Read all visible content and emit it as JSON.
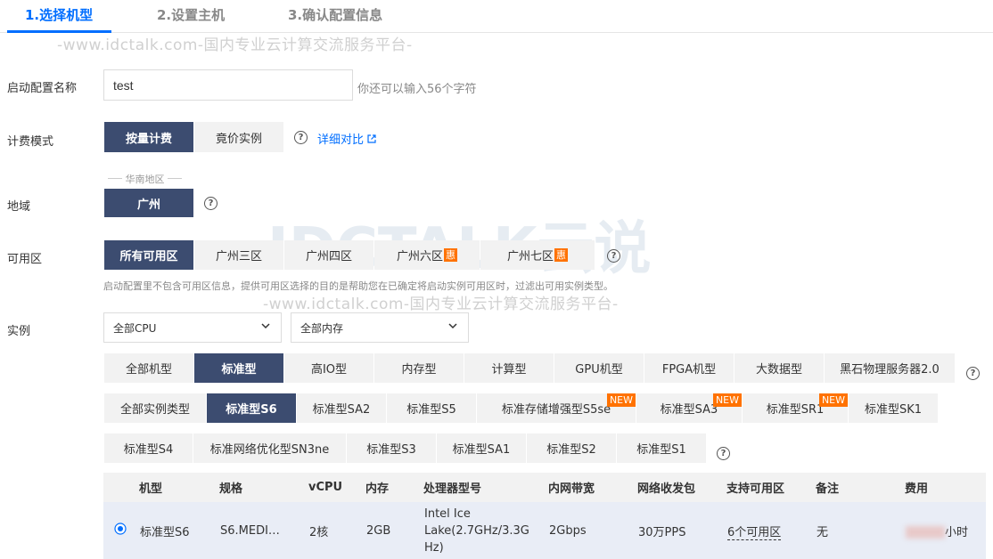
{
  "steps": [
    {
      "label": "1.选择机型"
    },
    {
      "label": "2.设置主机"
    },
    {
      "label": "3.确认配置信息"
    }
  ],
  "watermark": {
    "text": "-www.idctalk.com-国内专业云计算交流服务平台-",
    "logo": "IDCTALK云说"
  },
  "config_name": {
    "label": "启动配置名称",
    "value": "test",
    "hint": "你还可以输入56个字符"
  },
  "billing": {
    "label": "计费模式",
    "options": [
      "按量计费",
      "竟价实例"
    ],
    "selected": "按量计费",
    "compare_link": "详细对比"
  },
  "region": {
    "label": "地域",
    "group_label": "华南地区",
    "options": [
      "广州"
    ]
  },
  "zone": {
    "label": "可用区",
    "options": [
      "所有可用区",
      "广州三区",
      "广州四区",
      "广州六区",
      "广州七区"
    ],
    "discount_badge": "惠",
    "hint": "启动配置里不包含可用区信息，提供可用区选择的目的是帮助您在已确定将启动实例可用区时，过滤出可用实例类型。"
  },
  "instance": {
    "label": "实例",
    "cpu_select": "全部CPU",
    "mem_select": "全部内存",
    "families": [
      "全部机型",
      "标准型",
      "高IO型",
      "内存型",
      "计算型",
      "GPU机型",
      "FPGA机型",
      "大数据型",
      "黑石物理服务器2.0"
    ],
    "types_row1": [
      "全部实例类型",
      "标准型S6",
      "标准型SA2",
      "标准型S5",
      "标准存储增强型S5se",
      "标准型SA3",
      "标准型SR1",
      "标准型SK1"
    ],
    "types_row2": [
      "标准型S4",
      "标准网络优化型SN3ne",
      "标准型S3",
      "标准型SA1",
      "标准型S2",
      "标准型S1"
    ],
    "new_badge": "NEW"
  },
  "table": {
    "headers": [
      "机型",
      "规格",
      "vCPU",
      "内存",
      "处理器型号",
      "内网带宽",
      "网络收发包",
      "支持可用区",
      "备注",
      "费用"
    ],
    "rows": [
      {
        "model": "标准型S6",
        "spec": "S6.MEDI…",
        "vcpu": "2核",
        "memory": "2GB",
        "cpu_line1": "Intel Ice",
        "cpu_line2": "Lake(2.7GHz/3.3G",
        "cpu_line3": "Hz)",
        "bandwidth": "2Gbps",
        "pps": "30万PPS",
        "zones": "6个可用区",
        "note": "无",
        "price_suffix": "小时"
      }
    ]
  }
}
